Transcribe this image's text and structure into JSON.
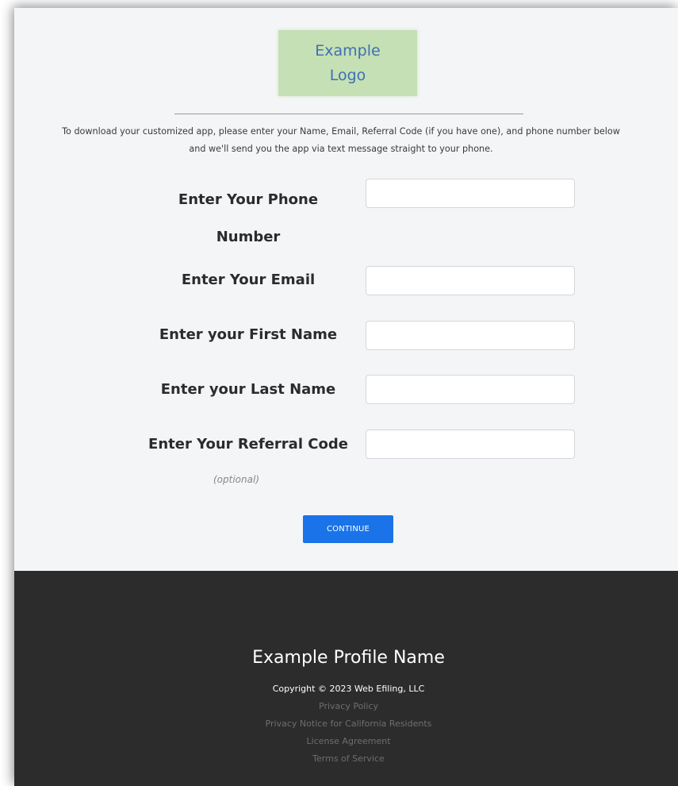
{
  "logo": {
    "text": "Example\nLogo"
  },
  "intro": {
    "line1": "To download your customized app, please enter your Name, Email, Referral Code (if you have one), and phone number below",
    "line2": "and we'll send you the app via text message straight to your phone."
  },
  "form": {
    "phone_label_line1": "Enter Your Phone",
    "phone_label_line2": "Number",
    "phone_value": "",
    "email_label": "Enter Your Email",
    "email_value": "",
    "first_name_label": "Enter your First Name",
    "first_name_value": "",
    "last_name_label": "Enter your Last Name",
    "last_name_value": "",
    "referral_label": "Enter Your Referral Code",
    "referral_value": "",
    "referral_hint": "(optional)",
    "continue_label": "CONTINUE"
  },
  "footer": {
    "profile_name": "Example Profile Name",
    "copyright": "Copyright © 2023 Web Efiling, LLC",
    "links": [
      "Privacy Policy",
      "Privacy Notice for California Residents",
      "License Agreement",
      "Terms of Service"
    ]
  },
  "colors": {
    "page_background": "#f4f5f7",
    "logo_background": "#c5e0b4",
    "logo_text": "#3f6fb5",
    "button": "#1a73e8",
    "footer_background": "#2c2c2c",
    "footer_link": "#6e6e6e"
  }
}
